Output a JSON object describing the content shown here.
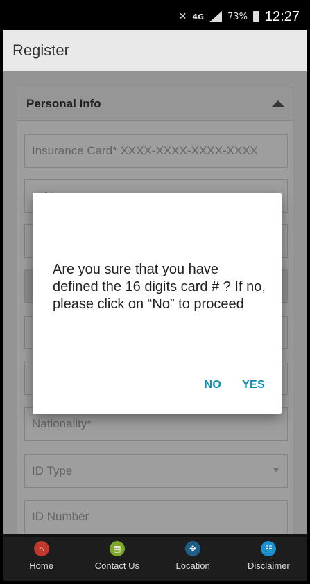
{
  "status_bar": {
    "network": "4G",
    "battery": "73%",
    "time": "12:27"
  },
  "appbar": {
    "title": "Register"
  },
  "form": {
    "section_title": "Personal Info",
    "fields": {
      "insurance_card": "Insurance Card* XXXX-XXXX-XXXX-XXXX",
      "name_partial": "N",
      "nationality": "Nationality*",
      "id_type": "ID Type",
      "id_number": "ID Number"
    }
  },
  "dialog": {
    "message": "Are you sure that you have defined the 16 digits card # ? If no, please click on “No” to proceed",
    "no_label": "NO",
    "yes_label": "YES"
  },
  "bottom_nav": {
    "items": [
      {
        "label": "Home",
        "icon": "home-icon"
      },
      {
        "label": "Contact Us",
        "icon": "contact-icon"
      },
      {
        "label": "Location",
        "icon": "location-icon"
      },
      {
        "label": "Disclaimer",
        "icon": "disclaimer-icon"
      }
    ]
  },
  "colors": {
    "accent": "#0d8fb3",
    "nav_background": "#1d1d1d"
  }
}
